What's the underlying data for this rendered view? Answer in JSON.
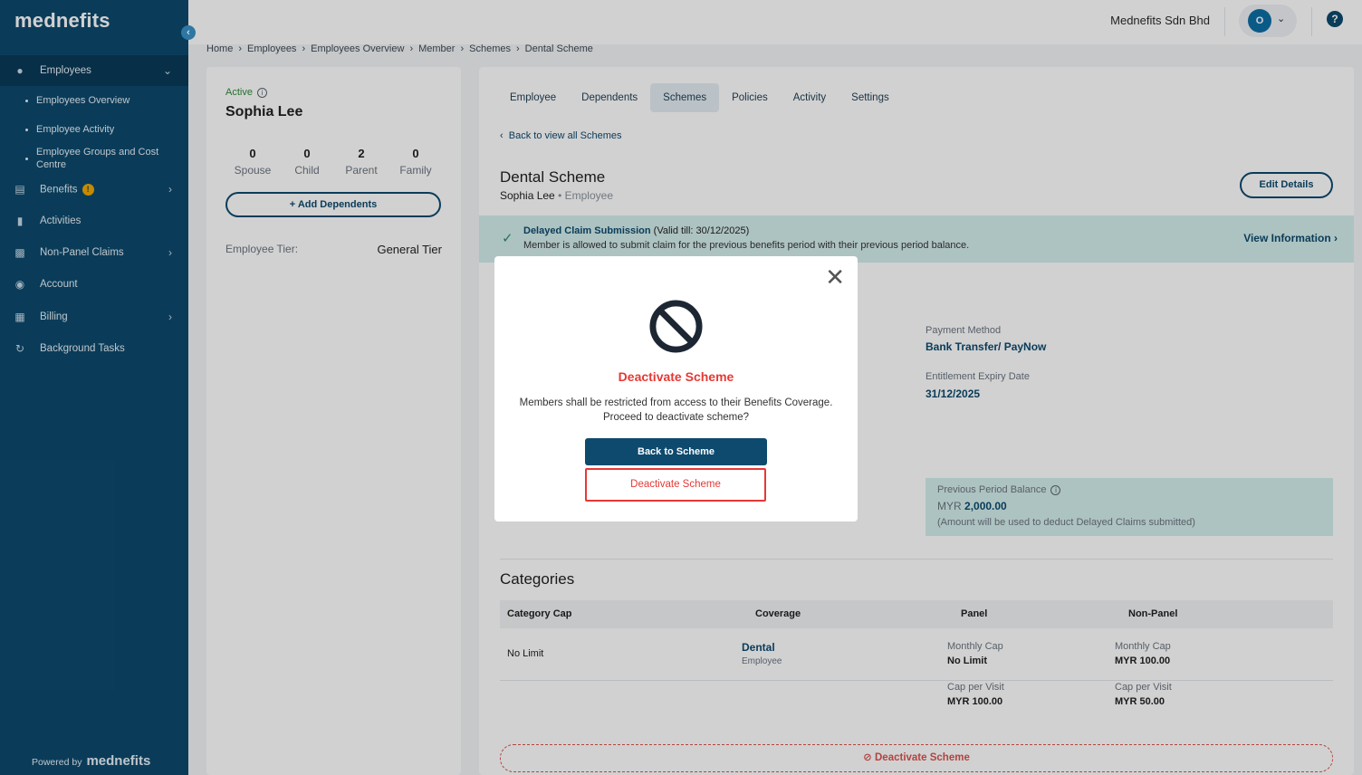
{
  "sidebar": {
    "logo": "mednefits",
    "items": [
      {
        "label": "Employees"
      },
      {
        "label": "Benefits",
        "badge": "!"
      },
      {
        "label": "Activities"
      },
      {
        "label": "Non-Panel Claims"
      },
      {
        "label": "Account"
      },
      {
        "label": "Billing"
      },
      {
        "label": "Background Tasks"
      }
    ],
    "sub_items": [
      {
        "label": "Employees Overview"
      },
      {
        "label": "Employee Activity"
      },
      {
        "label": "Employee Groups and Cost Centre"
      }
    ],
    "powered_by": "Powered by",
    "powered_brand": "mednefits"
  },
  "topbar": {
    "company": "Mednefits Sdn Bhd",
    "avatar_initial": "O",
    "help": "?"
  },
  "breadcrumb": [
    "Home",
    "Employees",
    "Employees Overview",
    "Member",
    "Schemes",
    "Dental Scheme"
  ],
  "member": {
    "status": "Active",
    "name": "Sophia Lee",
    "stats": [
      {
        "value": "0",
        "label": "Spouse"
      },
      {
        "value": "0",
        "label": "Child"
      },
      {
        "value": "2",
        "label": "Parent"
      },
      {
        "value": "0",
        "label": "Family"
      }
    ],
    "add_dependents": "Add Dependents",
    "tier_label": "Employee Tier:",
    "tier_value": "General Tier"
  },
  "main": {
    "tabs": [
      {
        "label": "Employee"
      },
      {
        "label": "Dependents"
      },
      {
        "label": "Schemes"
      },
      {
        "label": "Policies"
      },
      {
        "label": "Activity"
      },
      {
        "label": "Settings"
      }
    ],
    "back_link": "Back to view all Schemes",
    "scheme_title": "Dental Scheme",
    "scheme_member": "Sophia Lee",
    "scheme_role": "Employee",
    "edit_button": "Edit Details",
    "notice": {
      "title": "Delayed Claim Submission",
      "valid": "(Valid till: 30/12/2025)",
      "message": "Member is allowed to submit claim for the previous benefits period with their previous period balance.",
      "link": "View Information"
    },
    "payment_method_label": "Payment Method",
    "payment_method_value": "Bank Transfer/ PayNow",
    "expiry_label": "Entitlement Expiry Date",
    "expiry_value": "31/12/2025",
    "prev_balance": {
      "label": "Previous Period Balance",
      "currency": "MYR",
      "amount": "2,000.00",
      "note": "(Amount will be used to deduct Delayed Claims submitted)"
    },
    "categories": {
      "title": "Categories",
      "headers": [
        "Category Cap",
        "Coverage",
        "Panel",
        "Non-Panel"
      ],
      "row": {
        "cap": "No Limit",
        "coverage": "Dental",
        "coverage_sub": "Employee",
        "panel_monthly_label": "Monthly Cap",
        "panel_monthly_value": "No Limit",
        "panel_visit_label": "Cap per Visit",
        "panel_visit_value": "MYR 100.00",
        "nonpanel_monthly_label": "Monthly Cap",
        "nonpanel_monthly_value": "MYR 100.00",
        "nonpanel_visit_label": "Cap per Visit",
        "nonpanel_visit_value": "MYR 50.00"
      }
    },
    "deactivate_bottom": "Deactivate Scheme"
  },
  "modal": {
    "title": "Deactivate Scheme",
    "line1": "Members shall be restricted from access to their Benefits Coverage.",
    "line2": "Proceed to deactivate scheme?",
    "back_button": "Back to Scheme",
    "deactivate_button": "Deactivate Scheme"
  },
  "colors": {
    "sidebar": "#0d4a6e",
    "accent": "#0d4a6e",
    "danger": "#e53935",
    "notice_bg": "#d4eeec"
  }
}
